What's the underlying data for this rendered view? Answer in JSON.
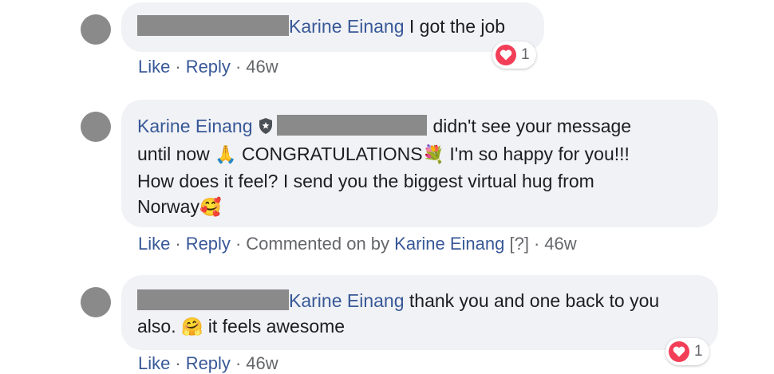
{
  "colors": {
    "bubble": "#f0f2f5",
    "name": "#385898",
    "meta": "#65676b",
    "avatar": "#8a8a8a",
    "heart": "#f33e58"
  },
  "comments": [
    {
      "author": "Karine Einang",
      "text": " I got the job",
      "reaction": {
        "icon": "heart-icon",
        "count": "1"
      },
      "actions": {
        "like": "Like",
        "reply": "Reply",
        "time": "46w"
      }
    },
    {
      "author": "Karine Einang",
      "text_parts": {
        "a": "didn't see your message",
        "b": "until now ",
        "c": " CONGRATULATIONS",
        "d": " I'm so happy for you!!!",
        "e": "How does it feel? I send you the biggest virtual hug from",
        "f": "Norway"
      },
      "emojis": {
        "pray": "🙏",
        "bouquet": "💐",
        "love": "🥰"
      },
      "actions": {
        "like": "Like",
        "reply": "Reply",
        "commented_on": "Commented on by",
        "commented_by": "Karine Einang",
        "help": "[?]",
        "time": "46w"
      }
    },
    {
      "author": "Karine Einang",
      "text": " thank you and one back to you",
      "text2a": "also. ",
      "emoji": "🤗",
      "text2b": " it feels awesome",
      "reaction": {
        "icon": "heart-icon",
        "count": "1"
      },
      "actions": {
        "like": "Like",
        "reply": "Reply",
        "time": "46w"
      }
    }
  ]
}
